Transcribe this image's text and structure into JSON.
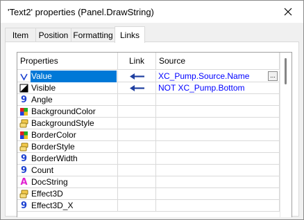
{
  "window": {
    "title": "'Text2' properties (Panel.DrawString)"
  },
  "tabs": [
    {
      "label": "Item"
    },
    {
      "label": "Position"
    },
    {
      "label": "Formatting"
    },
    {
      "label": "Links",
      "active": true
    }
  ],
  "grid": {
    "headers": {
      "properties": "Properties",
      "link": "Link",
      "source": "Source"
    },
    "rows": [
      {
        "name": "Value",
        "icon": "value-icon",
        "selected": true,
        "linked": true,
        "source": "XC_Pump.Source.Name",
        "has_browse": true,
        "browse_label": "..."
      },
      {
        "name": "Visible",
        "icon": "visible-icon",
        "linked": true,
        "source": "NOT XC_Pump.Bottom"
      },
      {
        "name": "Angle",
        "icon": "number-icon"
      },
      {
        "name": "BackgroundColor",
        "icon": "color-icon"
      },
      {
        "name": "BackgroundStyle",
        "icon": "style-icon"
      },
      {
        "name": "BorderColor",
        "icon": "color-icon"
      },
      {
        "name": "BorderStyle",
        "icon": "style-icon"
      },
      {
        "name": "BorderWidth",
        "icon": "number-icon"
      },
      {
        "name": "Count",
        "icon": "number-icon"
      },
      {
        "name": "DocString",
        "icon": "string-icon"
      },
      {
        "name": "Effect3D",
        "icon": "style-icon"
      },
      {
        "name": "Effect3D_X",
        "icon": "number-icon"
      }
    ]
  },
  "colors": {
    "accent": "#0078d7",
    "link_text": "#0000ff",
    "number_icon": "#1a3fd0",
    "string_icon": "#e020d0"
  }
}
